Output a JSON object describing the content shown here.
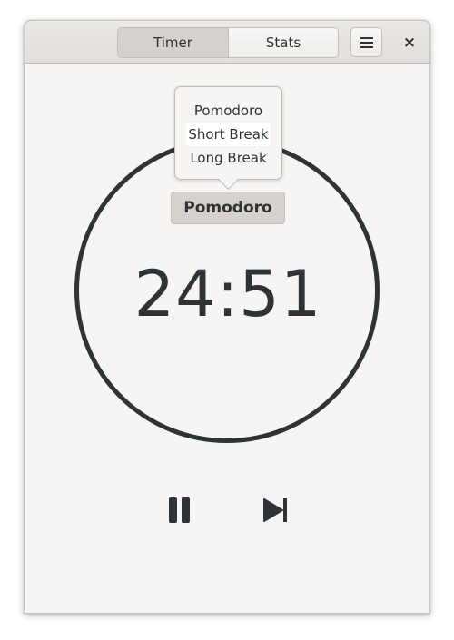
{
  "header": {
    "tabs": [
      {
        "label": "Timer",
        "active": true
      },
      {
        "label": "Stats",
        "active": false
      }
    ],
    "menu_icon": "hamburger-menu-icon",
    "close_label": "×"
  },
  "mode_menu": {
    "items": [
      "Pomodoro",
      "Short Break",
      "Long Break"
    ],
    "hovered": "Short Break"
  },
  "timer": {
    "mode_label": "Pomodoro",
    "time": "24:51"
  },
  "controls": {
    "pause_icon": "pause-icon",
    "skip_icon": "skip-forward-icon"
  },
  "colors": {
    "foreground": "#2e3436",
    "background": "#f6f5f4",
    "active_tab": "#d6d1cd"
  }
}
